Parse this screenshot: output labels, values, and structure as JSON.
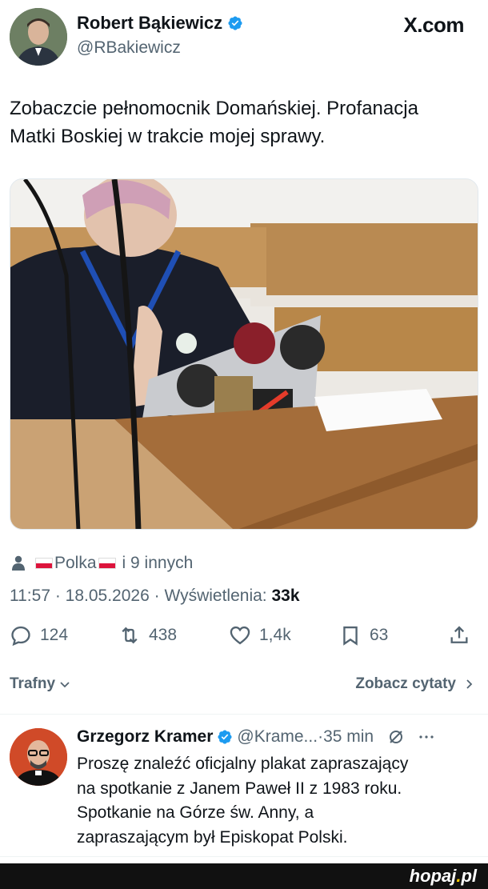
{
  "author": {
    "name": "Robert Bąkiewicz",
    "handle": "@RBakiewicz"
  },
  "site": "X.com",
  "tweet": {
    "text_line1": "Zobaczcie pełnomocnik Domańskiej. Profanacja",
    "text_line2": "Matki Boskiej w trakcie mojej sprawy."
  },
  "liked_by": {
    "name": "Polka",
    "others": "i 9 innych"
  },
  "meta": {
    "time": "11:57",
    "date": "18.05.2026",
    "views_label": "Wyświetlenia:",
    "views_value": "33k"
  },
  "actions": {
    "replies": "124",
    "reposts": "438",
    "likes": "1,4k",
    "bookmarks": "63"
  },
  "sort_label": "Trafny",
  "quotes_label": "Zobacz cytaty",
  "reply": {
    "name": "Grzegorz Kramer",
    "handle": "@Krame...",
    "time": "35 min",
    "line1": "Proszę znaleźć oficjalny plakat zapraszający",
    "line2": "na spotkanie z Janem Paweł II z 1983 roku.",
    "line3": "Spotkanie na Górze św. Anny, a",
    "line4": "zapraszającym był Episkopat Polski."
  },
  "watermark": {
    "text": "hopaj",
    "dot": ".",
    "tld": "pl"
  },
  "icons": {
    "verified": "verified-badge-icon",
    "reply": "reply-icon",
    "repost": "repost-icon",
    "like": "heart-icon",
    "bookmark": "bookmark-icon",
    "share": "share-icon"
  },
  "colors": {
    "verified_blue": "#1d9bf0",
    "muted": "#536471",
    "text": "#0f1419"
  }
}
